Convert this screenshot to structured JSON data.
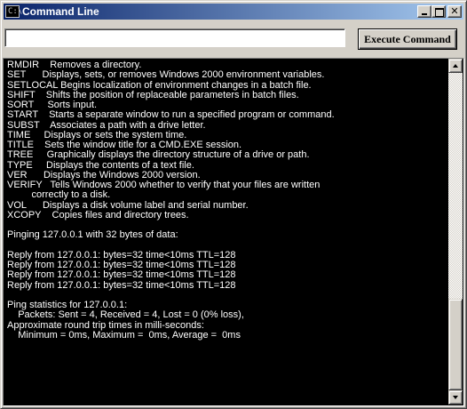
{
  "window": {
    "title": "Command Line",
    "icon_label": "C:\\",
    "minimize_glyph": "_",
    "maximize_glyph": "□",
    "close_glyph": "✕"
  },
  "toolbar": {
    "input_value": "",
    "execute_label": "Execute Command"
  },
  "console": {
    "lines": [
      "RMDIR    Removes a directory.",
      "SET      Displays, sets, or removes Windows 2000 environment variables.",
      "SETLOCAL Begins localization of environment changes in a batch file.",
      "SHIFT    Shifts the position of replaceable parameters in batch files.",
      "SORT     Sorts input.",
      "START    Starts a separate window to run a specified program or command.",
      "SUBST    Associates a path with a drive letter.",
      "TIME     Displays or sets the system time.",
      "TITLE    Sets the window title for a CMD.EXE session.",
      "TREE     Graphically displays the directory structure of a drive or path.",
      "TYPE     Displays the contents of a text file.",
      "VER      Displays the Windows 2000 version.",
      "VERIFY   Tells Windows 2000 whether to verify that your files are written",
      "         correctly to a disk.",
      "VOL      Displays a disk volume label and serial number.",
      "XCOPY    Copies files and directory trees.",
      "",
      "Pinging 127.0.0.1 with 32 bytes of data:",
      "",
      "Reply from 127.0.0.1: bytes=32 time<10ms TTL=128",
      "Reply from 127.0.0.1: bytes=32 time<10ms TTL=128",
      "Reply from 127.0.0.1: bytes=32 time<10ms TTL=128",
      "Reply from 127.0.0.1: bytes=32 time<10ms TTL=128",
      "",
      "Ping statistics for 127.0.0.1:",
      "    Packets: Sent = 4, Received = 4, Lost = 0 (0% loss),",
      "Approximate round trip times in milli-seconds:",
      "    Minimum = 0ms, Maximum =  0ms, Average =  0ms"
    ]
  },
  "colors": {
    "title_gradient_start": "#0a246a",
    "title_gradient_end": "#a6caf0",
    "console_bg": "#000000",
    "console_fg": "#ffffff",
    "chrome": "#d4d0c8"
  }
}
